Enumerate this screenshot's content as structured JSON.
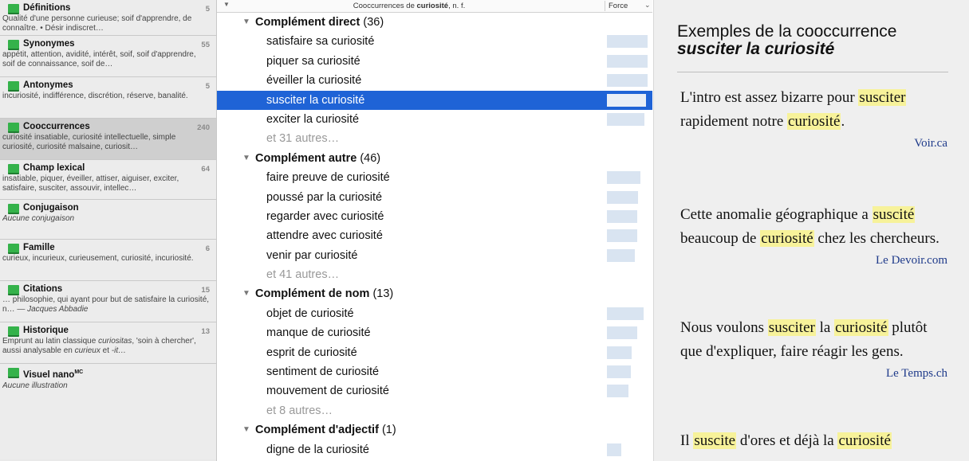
{
  "sidebar": {
    "items": [
      {
        "title": "Définitions",
        "count": "5",
        "desc": "Qualité d'une personne curieuse; soif d'apprendre, de connaître. • Désir indiscret…"
      },
      {
        "title": "Synonymes",
        "count": "55",
        "desc": "appétit, attention, avidité, intérêt, soif, soif d'apprendre, soif de connaissance, soif de…"
      },
      {
        "title": "Antonymes",
        "count": "5",
        "desc": "incuriosité, indifférence, discrétion, réserve, banalité."
      },
      {
        "title": "Cooccurrences",
        "count": "240",
        "desc": "curiosité insatiable, curiosité intellectuelle, simple curiosité, curiosité malsaine, curiosit…"
      },
      {
        "title": "Champ lexical",
        "count": "64",
        "desc": "insatiable, piquer, éveiller, attiser, aiguiser, exciter, satisfaire, susciter, assouvir, intellec…"
      },
      {
        "title": "Conjugaison",
        "count": "",
        "desc": "Aucune conjugaison"
      },
      {
        "title": "Famille",
        "count": "6",
        "desc": "curieux, incurieux, curieusement, curiosité, incuriosité."
      },
      {
        "title": "Citations",
        "count": "15",
        "desc": "… philosophie, qui ayant pour but de satisfaire la curiosité, n…",
        "author": "— Jacques Abbadie"
      },
      {
        "title": "Historique",
        "count": "13",
        "desc_a": "Emprunt au latin classique ",
        "desc_b": "curiositas",
        "desc_c": ", 'soin à chercher', aussi analysable en ",
        "desc_d": "curieux",
        "desc_e": " et ",
        "desc_f": "-it…"
      },
      {
        "title": "Visuel nano",
        "title_sup": "MC",
        "count": "",
        "desc": "Aucune illustration"
      }
    ]
  },
  "list": {
    "header_prefix": "Cooccurrences de ",
    "header_word": "curiosité",
    "header_suffix": ", n. f.",
    "force_label": "Force",
    "groups": [
      {
        "label": "Complément direct",
        "count": "(36)",
        "items": [
          "satisfaire sa curiosité",
          "piquer sa curiosité",
          "éveiller la curiosité",
          "susciter la curiosité",
          "exciter la curiosité"
        ],
        "force": [
          0.98,
          0.98,
          0.98,
          0.94,
          0.9
        ],
        "more": "et 31 autres…"
      },
      {
        "label": "Complément autre",
        "count": "(46)",
        "items": [
          "faire preuve de curiosité",
          "poussé par la curiosité",
          "regarder avec curiosité",
          "attendre avec curiosité",
          "venir par curiosité"
        ],
        "force": [
          0.8,
          0.75,
          0.73,
          0.73,
          0.68
        ],
        "more": "et 41 autres…"
      },
      {
        "label": "Complément de nom",
        "count": "(13)",
        "items": [
          "objet de curiosité",
          "manque de curiosité",
          "esprit de curiosité",
          "sentiment de curiosité",
          "mouvement de curiosité"
        ],
        "force": [
          0.88,
          0.73,
          0.6,
          0.58,
          0.52
        ],
        "more": "et 8 autres…"
      },
      {
        "label": "Complément d'adjectif",
        "count": "(1)",
        "items": [
          "digne de la curiosité"
        ],
        "force": [
          0.35
        ],
        "more": ""
      }
    ],
    "selected_item": "susciter la curiosité"
  },
  "examples": {
    "heading_line1": "Exemples de la cooccurrence",
    "heading_expr": "susciter la curiosité",
    "items": [
      {
        "parts": [
          "L'intro est assez bizarre pour ",
          "#susciter",
          " rapidement notre ",
          "#curiosité",
          "."
        ],
        "source": "Voir.ca"
      },
      {
        "parts": [
          "Cette anomalie géographique a ",
          "#suscité",
          " beaucoup de ",
          "#curiosité",
          " chez les chercheurs."
        ],
        "source": "Le Devoir.com"
      },
      {
        "parts": [
          "Nous voulons ",
          "#susciter",
          " la ",
          "#curiosité",
          " plutôt que d'expliquer, faire réagir les gens."
        ],
        "source": "Le Temps.ch"
      },
      {
        "parts": [
          "Il ",
          "#suscite",
          " d'ores et déjà la ",
          "#curiosité"
        ],
        "source": ""
      }
    ]
  },
  "colors": {
    "selection": "#1f63d6",
    "force_bar": "#d9e4f1",
    "highlight": "#f7f29a",
    "source_link": "#1e3a8a",
    "book_icon": "#34b24a"
  }
}
